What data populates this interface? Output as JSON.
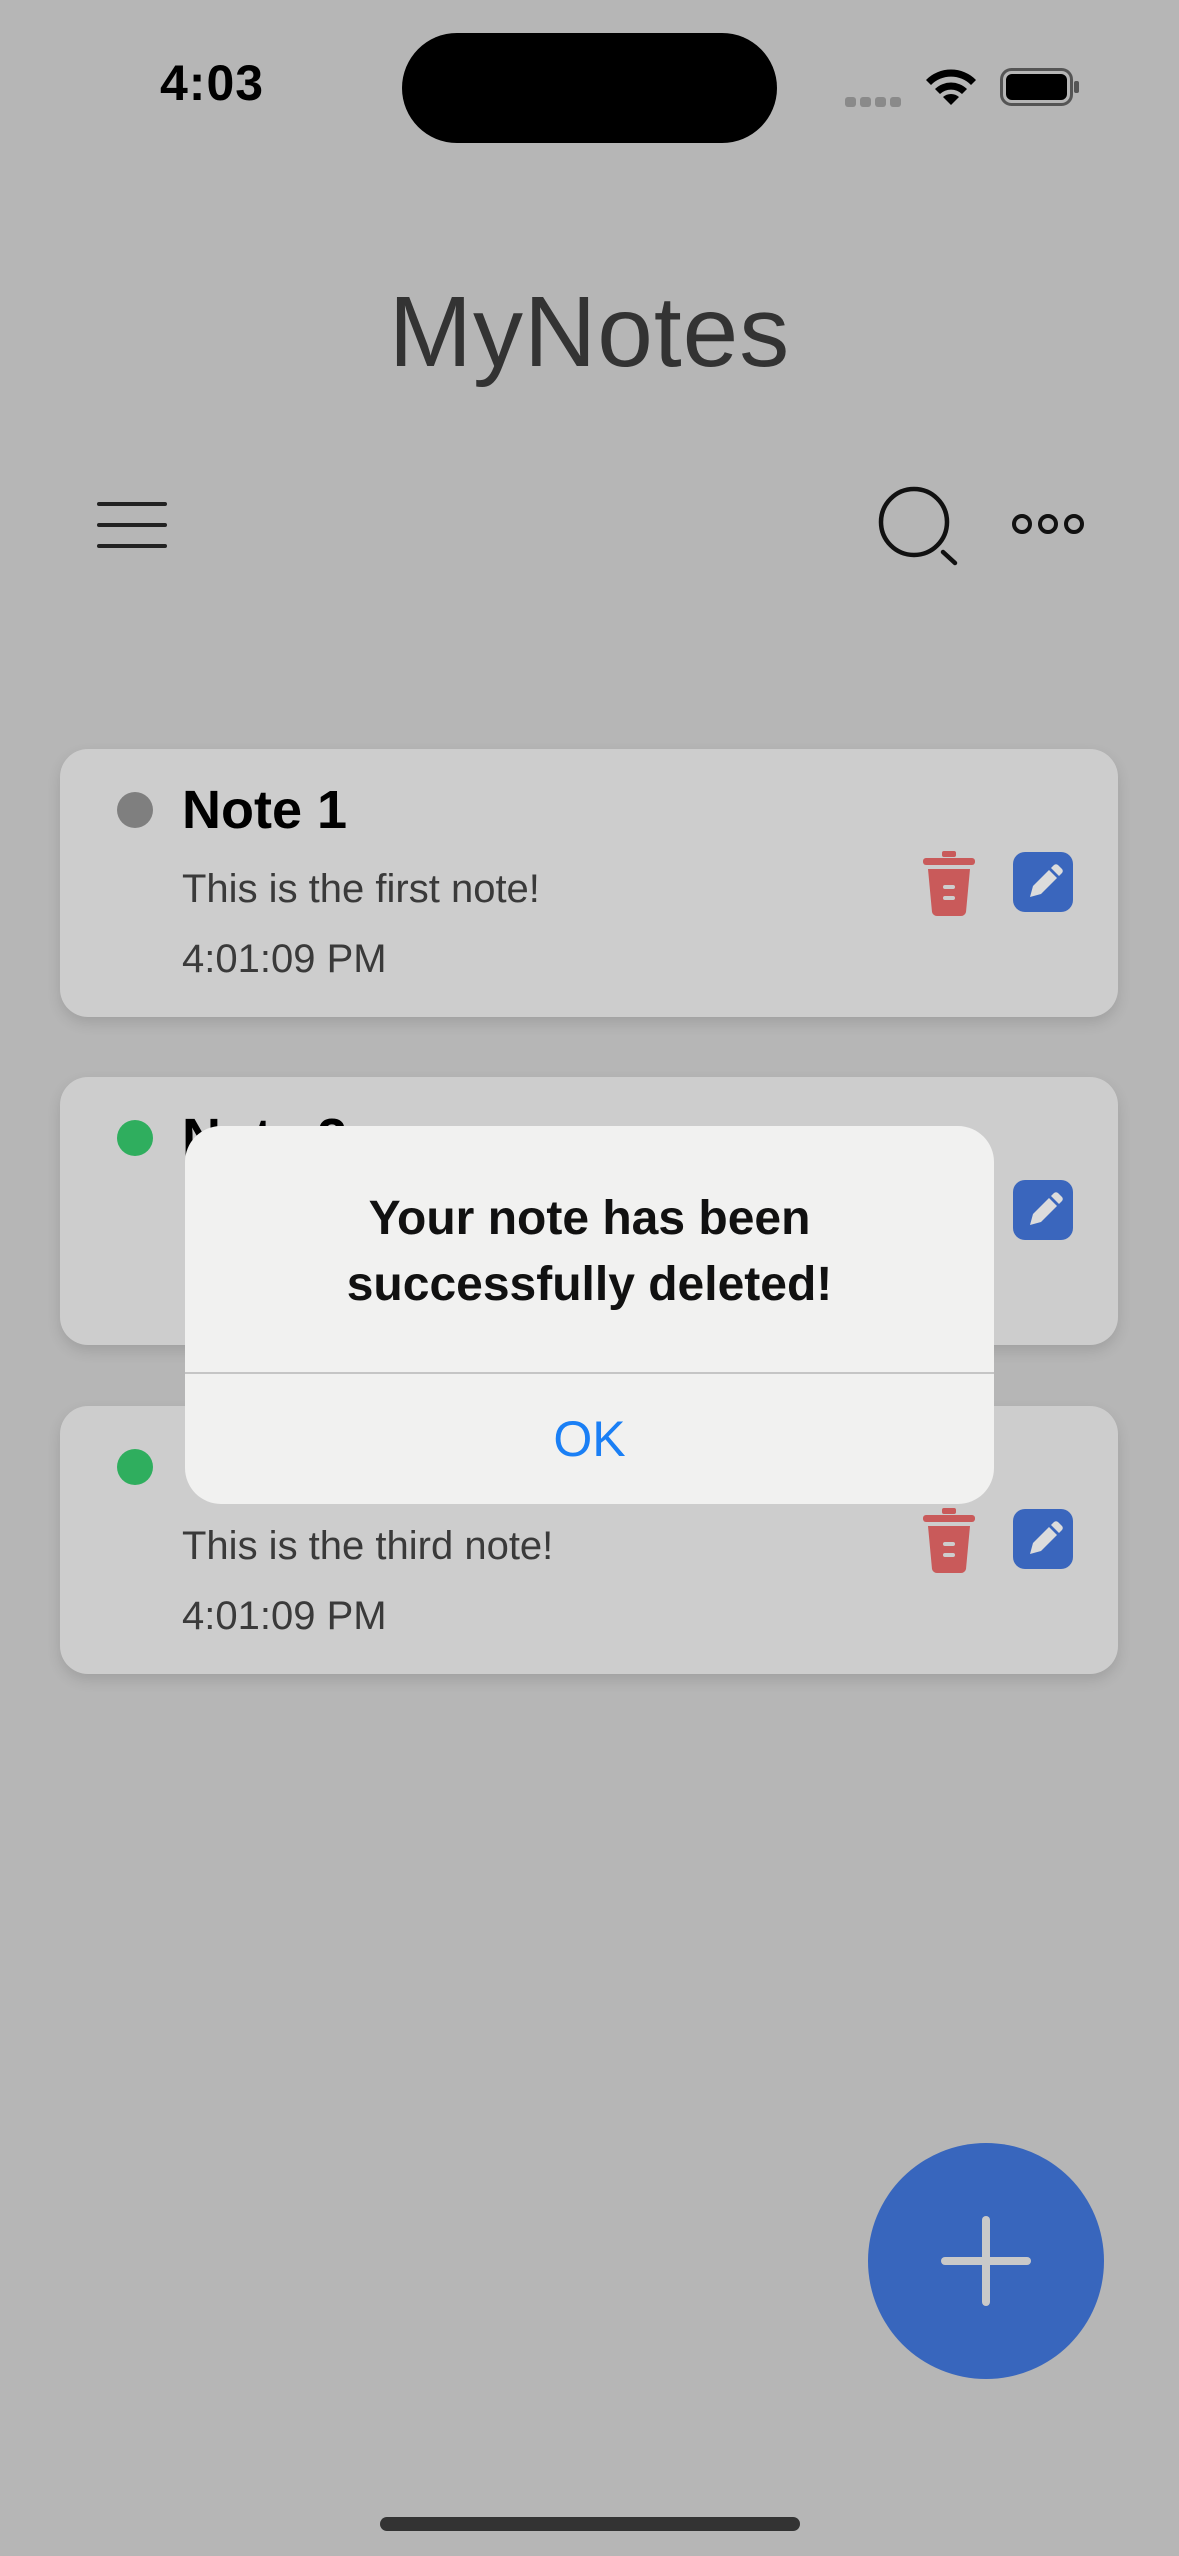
{
  "status_bar": {
    "time": "4:03"
  },
  "header": {
    "title": "MyNotes"
  },
  "notes": [
    {
      "title": "Note 1",
      "body": "This is the first note!",
      "time": "4:01:09 PM",
      "status_color": "#7f7f7f"
    },
    {
      "title": "Note 2",
      "body": "",
      "time": "",
      "status_color": "#2fae5e"
    },
    {
      "title": "",
      "body": "This is the third note!",
      "time": "4:01:09 PM",
      "status_color": "#2fae5e"
    }
  ],
  "alert": {
    "message_line1": "Your note has been",
    "message_line2": "successfully deleted!",
    "ok_label": "OK"
  },
  "icons": [
    "menu-icon",
    "search-icon",
    "more-icon",
    "trash-icon",
    "edit-icon",
    "plus-icon"
  ],
  "colors": {
    "accent": "#3866bd",
    "alert_button": "#1a7ff5",
    "delete": "#c95a5a"
  }
}
